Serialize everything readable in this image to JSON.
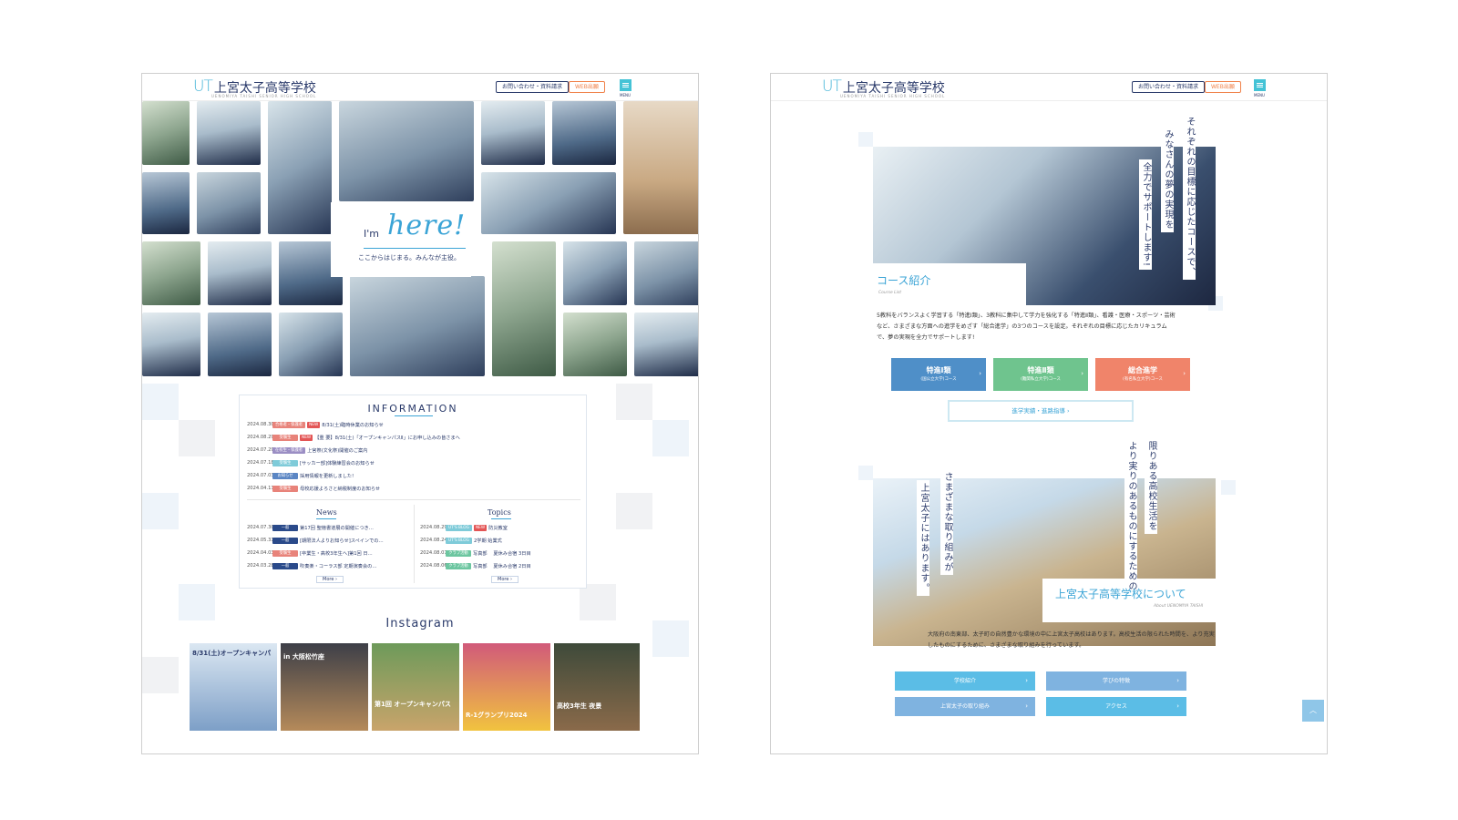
{
  "header": {
    "logo_mark": "UT",
    "logo_name": "上宮太子高等学校",
    "logo_sub": "UENOMIYA TAISHI SENIOR HIGH SCHOOL",
    "contact_label": "お問い合わせ・資料請求",
    "web_label": "WEB出願",
    "menu_label": "MENU"
  },
  "hero": {
    "im": "I'm",
    "here": "here!",
    "sub": "ここからはじまる。みんなが主役。"
  },
  "information": {
    "title": "INFORMATION",
    "items": [
      {
        "date": "2024.08.30",
        "tag": "合格者・保護者",
        "tag_color": "#e8837a",
        "is_new": true,
        "new_label": "NEW",
        "title": "8/31(土)臨時休業のお知らせ"
      },
      {
        "date": "2024.08.29",
        "tag": "受験生",
        "tag_color": "#e8837a",
        "is_new": true,
        "new_label": "NEW",
        "title": "【重 要】8/31(土)「オープンキャンパスⅡ」にお申し込みの皆さまへ"
      },
      {
        "date": "2024.07.29",
        "tag": "在校生・保護者",
        "tag_color": "#9b8ec4",
        "is_new": false,
        "title": "上宮祭(文化祭)開催のご案内"
      },
      {
        "date": "2024.07.18",
        "tag": "受験生",
        "tag_color": "#7fcbd9",
        "is_new": false,
        "title": "[サッカー部]体験練習会のお知らせ"
      },
      {
        "date": "2024.07.03",
        "tag": "お知らせ",
        "tag_color": "#5b86c4",
        "is_new": false,
        "title": "採用情報を更新しました!"
      },
      {
        "date": "2024.04.11",
        "tag": "受験生",
        "tag_color": "#e8837a",
        "is_new": false,
        "title": "母校応援よろさと納税制度のお知らせ"
      }
    ],
    "news_title": "News",
    "news": [
      {
        "date": "2024.07.30",
        "tag": "一般",
        "tag_color": "#2a4a8a",
        "title": "第17回 聖徳書道展の開催につき…"
      },
      {
        "date": "2024.05.31",
        "tag": "一般",
        "tag_color": "#2a4a8a",
        "title": "[期限法人よりお知らせ]スペインでの…"
      },
      {
        "date": "2024.04.03",
        "tag": "受験生",
        "tag_color": "#e8837a",
        "title": "[卒業生・高校3年生へ]第1回 日…"
      },
      {
        "date": "2024.03.28",
        "tag": "一般",
        "tag_color": "#2a4a8a",
        "title": "吹奏楽・コーラス部 定期演奏会の…"
      }
    ],
    "topics_title": "Topics",
    "topics": [
      {
        "date": "2024.08.29",
        "tag": "UT'S BLOG",
        "tag_color": "#7fcbd9",
        "is_new": true,
        "new_label": "NEW",
        "title": "防災教室"
      },
      {
        "date": "2024.08.24",
        "tag": "UT'S BLOG",
        "tag_color": "#7fcbd9",
        "is_new": false,
        "title": "2学期 始業式"
      },
      {
        "date": "2024.08.07",
        "tag": "クラブ活動",
        "tag_color": "#6cc6a0",
        "is_new": false,
        "title": "写真部 　夏休み合宿 3日目"
      },
      {
        "date": "2024.08.06",
        "tag": "クラブ活動",
        "tag_color": "#6cc6a0",
        "is_new": false,
        "title": "写真部 　夏休み合宿 2日目"
      }
    ],
    "more_label": "More ›"
  },
  "instagram": {
    "title": "Instagram",
    "posts": [
      {
        "caption": "8/31(土)オープンキャンパ",
        "color1": "#dbe7f2",
        "color2": "#7d9fc7",
        "text_color": "#2a3a6a"
      },
      {
        "caption": "in 大阪松竹座",
        "color1": "#3d3f48",
        "color2": "#b58a5a",
        "text_color": "#ffffff"
      },
      {
        "caption": "第1回 オープンキャンパス",
        "color1": "#6d9a5a",
        "color2": "#c9a46b",
        "text_color": "#ffffff"
      },
      {
        "caption": "R-1グランプリ2024",
        "color1": "#d15a7a",
        "color2": "#f1c33f",
        "text_color": "#ffffff"
      },
      {
        "caption": "高校3年生 夜景",
        "color1": "#3e4a3a",
        "color2": "#8a6a4a",
        "text_color": "#ffffff"
      }
    ]
  },
  "course": {
    "vertical_1": "それぞれの目標に応じたコースで、",
    "vertical_2": "みなさんの夢の実現を",
    "vertical_3": "全力でサポートします!",
    "title": "コース紹介",
    "sub": "Course List",
    "body": "5教科をバランスよく学習する「特進Ⅰ類」、3教科に集中して学力を強化する「特進Ⅱ類」、看護・医療・スポーツ・芸術など、さまざまな方面への進学をめざす「総合進学」の3つのコースを設定。それぞれの目標に応じたカリキュラムで、夢の実現を全力でサポートします!",
    "buttons": [
      {
        "label": "特進Ⅰ類",
        "sub": "(国公立大学)コース",
        "color": "#4f8fc8"
      },
      {
        "label": "特進Ⅱ類",
        "sub": "(難関私立大学)コース",
        "color": "#6fc48e"
      },
      {
        "label": "総合進学",
        "sub": "(有名私立大学)コース",
        "color": "#f0846a"
      }
    ],
    "results_label": "進学実績・進路指導 ›"
  },
  "about": {
    "vertical_1": "限りある高校生活を",
    "vertical_2": "より実りのあるものにするための",
    "vertical_3": "さまざまな取り組みが",
    "vertical_4": "上宮太子にはあります。",
    "title": "上宮太子高等学校について",
    "sub": "About UENOMIYA TAISHI",
    "body": "大阪府の南東部、太子町の自然豊かな環境の中に上宮太子高校はあります。高校生活の限られた時間を、より充実したものにするために、さまざまな取り組みを行っています。",
    "nav": [
      {
        "label": "学校紹介",
        "color": "#5bbde6"
      },
      {
        "label": "学びの特徴",
        "color": "#7fb3e0"
      },
      {
        "label": "上宮太子の取り組み",
        "color": "#7fb3e0"
      },
      {
        "label": "アクセス",
        "color": "#5bbde6"
      }
    ],
    "totop_label": "︿"
  }
}
